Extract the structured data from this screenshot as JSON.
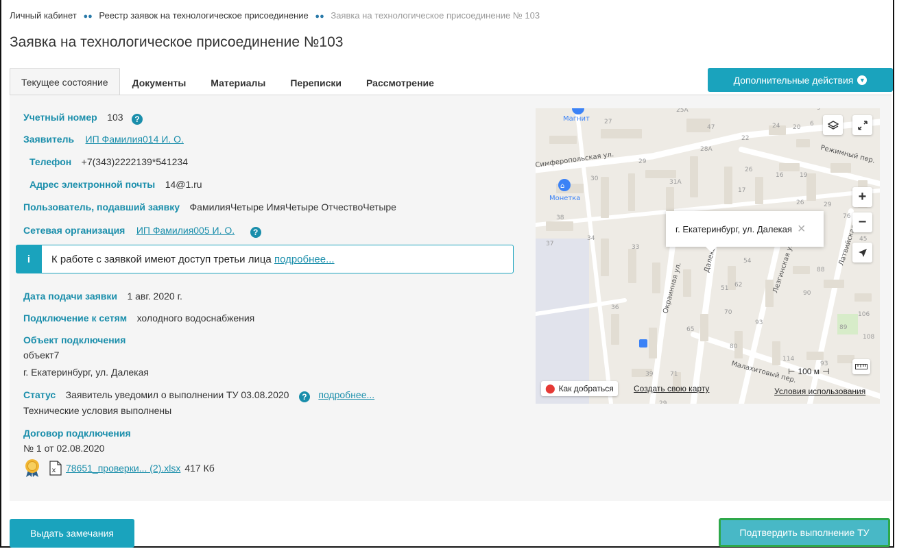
{
  "breadcrumb": {
    "items": [
      "Личный кабинет",
      "Реестр заявок на технологическое присоединение"
    ],
    "current": "Заявка на технологическое присоединение № 103"
  },
  "page_title": "Заявка на технологическое присоединение №103",
  "tabs": [
    "Текущее состояние",
    "Документы",
    "Материалы",
    "Переписки",
    "Рассмотрение"
  ],
  "extra_actions": "Дополнительные действия",
  "fields": {
    "account_label": "Учетный номер",
    "account_value": "103",
    "applicant_label": "Заявитель",
    "applicant_value": "ИП Фамилия014 И. О.",
    "phone_label": "Телефон",
    "phone_value": "+7(343)2222139*541234",
    "email_label": "Адрес электронной почты",
    "email_value": "14@1.ru",
    "user_label": "Пользователь, подавший заявку",
    "user_value": "ФамилияЧетыре ИмяЧетыре ОтчествоЧетыре",
    "network_label": "Сетевая организация",
    "network_value": "ИП Фамилия005 И. О.",
    "date_label": "Дата подачи заявки",
    "date_value": "1 авг. 2020 г.",
    "connection_label": "Подключение к сетям",
    "connection_value": "холодного водоснабжения",
    "object_label": "Объект подключения",
    "object_name": "объект7",
    "object_address": "г. Екатеринбург, ул. Далекая",
    "status_label": "Статус",
    "status_value": "Заявитель уведомил о выполнении ТУ 03.08.2020",
    "status_more": "подробнее...",
    "status_sub": "Технические условия выполнены",
    "contract_label": "Договор подключения",
    "contract_value": "№ 1 от 02.08.2020",
    "file_name": "78651_проверки... (2).xlsx",
    "file_size": "417 Кб"
  },
  "info": {
    "icon": "i",
    "text": "К работе с заявкой имеют доступ третьи лица",
    "link": "подробнее..."
  },
  "map": {
    "popup": "г. Екатеринбург, ул. Далекая",
    "route": "Как добраться",
    "create": "Создать свою карту",
    "terms": "Условия использования",
    "scale": "100 м",
    "pois": [
      "Магнит",
      "Монетка"
    ],
    "streets": [
      "Симферопольская ул.",
      "Режимный пер.",
      "Окраинная ул.",
      "Далекая ул.",
      "Лезгинская ул.",
      "Латвийская ул.",
      "Малахитовый пер."
    ],
    "house_numbers": [
      "25А",
      "27",
      "47",
      "24",
      "20",
      "9",
      "6",
      "22",
      "28А",
      "29",
      "26",
      "16",
      "19",
      "30",
      "31А",
      "17",
      "26",
      "29",
      "76",
      "38",
      "34",
      "33",
      "54",
      "45",
      "37",
      "88",
      "62",
      "51",
      "90",
      "36",
      "70",
      "93",
      "106",
      "89",
      "65",
      "108",
      "80",
      "114",
      "93",
      "39",
      "71",
      "29"
    ]
  },
  "buttons": {
    "remarks": "Выдать замечания",
    "confirm": "Подтвердить выполнение ТУ"
  },
  "colors": {
    "accent": "#1aa3bd",
    "label": "#1a8eab",
    "confirm": "#48b8c6",
    "highlight": "#2ea84a"
  }
}
